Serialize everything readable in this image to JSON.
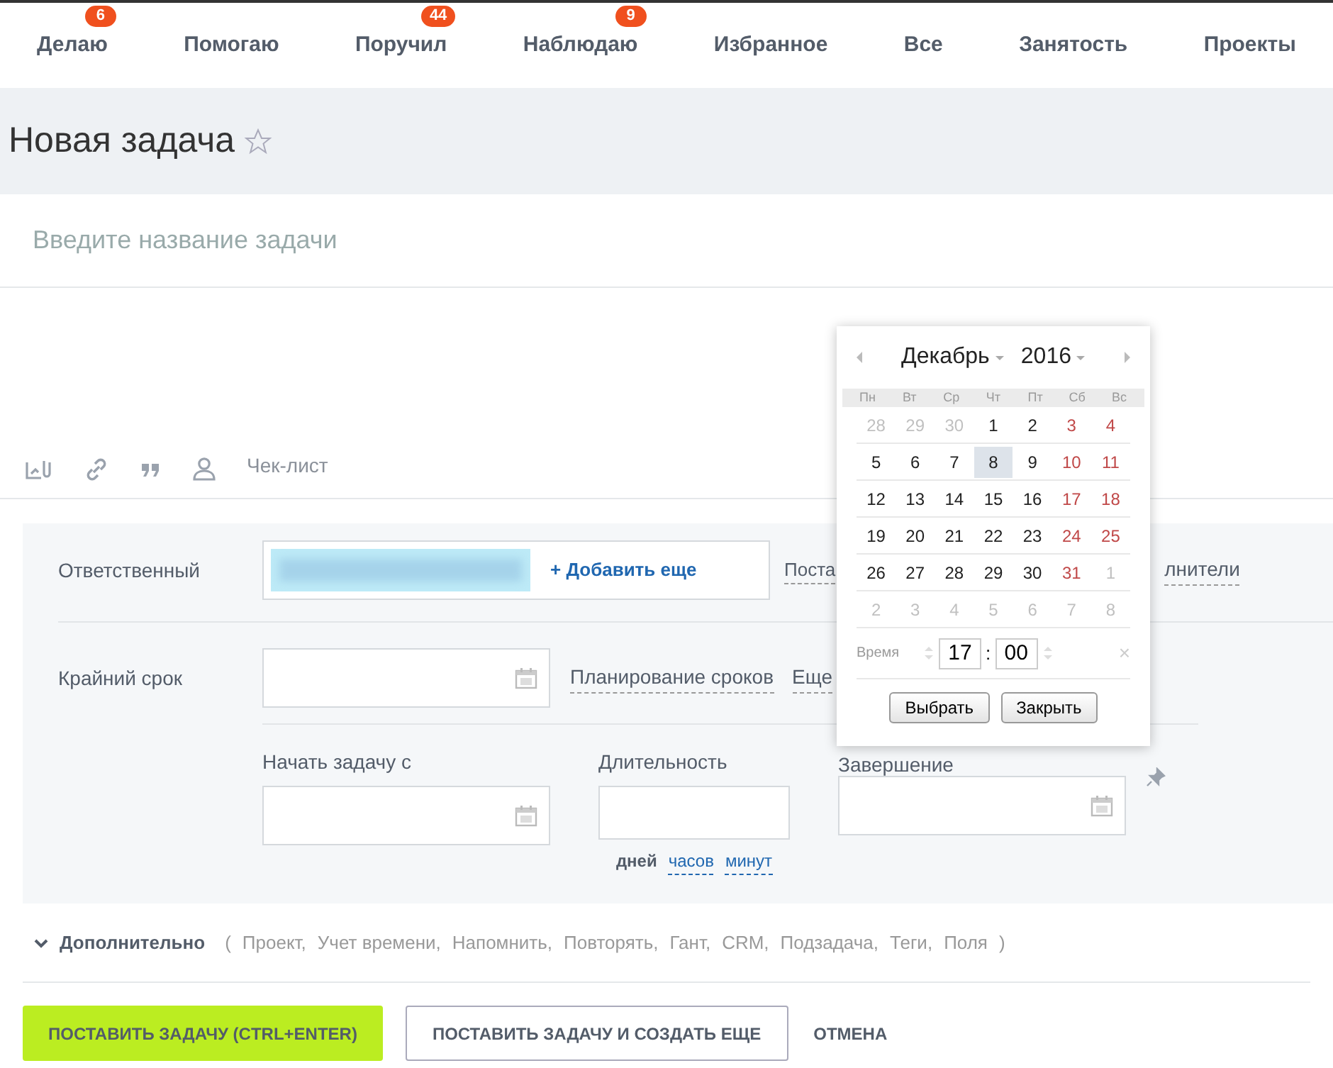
{
  "tabs": [
    {
      "label": "Делаю",
      "badge": "6"
    },
    {
      "label": "Помогаю"
    },
    {
      "label": "Поручил",
      "badge": "44"
    },
    {
      "label": "Наблюдаю",
      "badge": "9"
    },
    {
      "label": "Избранное"
    },
    {
      "label": "Все"
    },
    {
      "label": "Занятость"
    },
    {
      "label": "Проекты"
    }
  ],
  "page_title": "Новая задача",
  "title_field": {
    "placeholder": "Введите название задачи"
  },
  "toolbar": {
    "checklist": "Чек-лист"
  },
  "responsible": {
    "label": "Ответственный",
    "add": "+ Добавить еще",
    "link_left": "Поста",
    "link_right": "лнители"
  },
  "deadline": {
    "label": "Крайний срок",
    "planning": "Планирование сроков",
    "more": "Еще"
  },
  "schedule": {
    "start_label": "Начать задачу с",
    "duration_label": "Длительность",
    "end_label": "Завершение",
    "units": [
      {
        "label": "дней",
        "selected": true
      },
      {
        "label": "часов",
        "selected": false
      },
      {
        "label": "минут",
        "selected": false
      }
    ]
  },
  "extra": {
    "title": "Дополнительно",
    "open_paren": "(",
    "items": [
      "Проект,",
      "Учет времени,",
      "Напомнить,",
      "Повторять,",
      "Гант,",
      "CRM,",
      "Подзадача,",
      "Теги,",
      "Поля"
    ],
    "close_paren": ")"
  },
  "buttons": {
    "submit": "ПОСТАВИТЬ ЗАДАЧУ (CTRL+ENTER)",
    "submit_more": "ПОСТАВИТЬ ЗАДАЧУ И СОЗДАТЬ ЕЩЕ",
    "cancel": "ОТМЕНА"
  },
  "calendar": {
    "month": "Декабрь",
    "year": "2016",
    "weekdays": [
      "Пн",
      "Вт",
      "Ср",
      "Чт",
      "Пт",
      "Сб",
      "Вс"
    ],
    "weeks": [
      [
        {
          "d": "28",
          "kind": "other",
          "selected": false
        },
        {
          "d": "29",
          "kind": "other",
          "selected": false
        },
        {
          "d": "30",
          "kind": "other",
          "selected": false
        },
        {
          "d": "1",
          "kind": "day",
          "selected": false
        },
        {
          "d": "2",
          "kind": "day",
          "selected": false
        },
        {
          "d": "3",
          "kind": "weekend",
          "selected": false
        },
        {
          "d": "4",
          "kind": "weekend",
          "selected": false
        }
      ],
      [
        {
          "d": "5",
          "kind": "day",
          "selected": false
        },
        {
          "d": "6",
          "kind": "day",
          "selected": false
        },
        {
          "d": "7",
          "kind": "day",
          "selected": false
        },
        {
          "d": "8",
          "kind": "day",
          "selected": true
        },
        {
          "d": "9",
          "kind": "day",
          "selected": false
        },
        {
          "d": "10",
          "kind": "weekend",
          "selected": false
        },
        {
          "d": "11",
          "kind": "weekend",
          "selected": false
        }
      ],
      [
        {
          "d": "12",
          "kind": "day",
          "selected": false
        },
        {
          "d": "13",
          "kind": "day",
          "selected": false
        },
        {
          "d": "14",
          "kind": "day",
          "selected": false
        },
        {
          "d": "15",
          "kind": "day",
          "selected": false
        },
        {
          "d": "16",
          "kind": "day",
          "selected": false
        },
        {
          "d": "17",
          "kind": "weekend",
          "selected": false
        },
        {
          "d": "18",
          "kind": "weekend",
          "selected": false
        }
      ],
      [
        {
          "d": "19",
          "kind": "day",
          "selected": false
        },
        {
          "d": "20",
          "kind": "day",
          "selected": false
        },
        {
          "d": "21",
          "kind": "day",
          "selected": false
        },
        {
          "d": "22",
          "kind": "day",
          "selected": false
        },
        {
          "d": "23",
          "kind": "day",
          "selected": false
        },
        {
          "d": "24",
          "kind": "weekend",
          "selected": false
        },
        {
          "d": "25",
          "kind": "weekend",
          "selected": false
        }
      ],
      [
        {
          "d": "26",
          "kind": "day",
          "selected": false
        },
        {
          "d": "27",
          "kind": "day",
          "selected": false
        },
        {
          "d": "28",
          "kind": "day",
          "selected": false
        },
        {
          "d": "29",
          "kind": "day",
          "selected": false
        },
        {
          "d": "30",
          "kind": "day",
          "selected": false
        },
        {
          "d": "31",
          "kind": "weekend",
          "selected": false
        },
        {
          "d": "1",
          "kind": "other",
          "selected": false
        }
      ],
      [
        {
          "d": "2",
          "kind": "other",
          "selected": false
        },
        {
          "d": "3",
          "kind": "other",
          "selected": false
        },
        {
          "d": "4",
          "kind": "other",
          "selected": false
        },
        {
          "d": "5",
          "kind": "other",
          "selected": false
        },
        {
          "d": "6",
          "kind": "other",
          "selected": false
        },
        {
          "d": "7",
          "kind": "other",
          "selected": false
        },
        {
          "d": "8",
          "kind": "other",
          "selected": false
        }
      ]
    ],
    "time_label": "Время",
    "hours": "17",
    "separator": ":",
    "minutes": "00",
    "clear": "×",
    "select": "Выбрать",
    "close": "Закрыть"
  }
}
